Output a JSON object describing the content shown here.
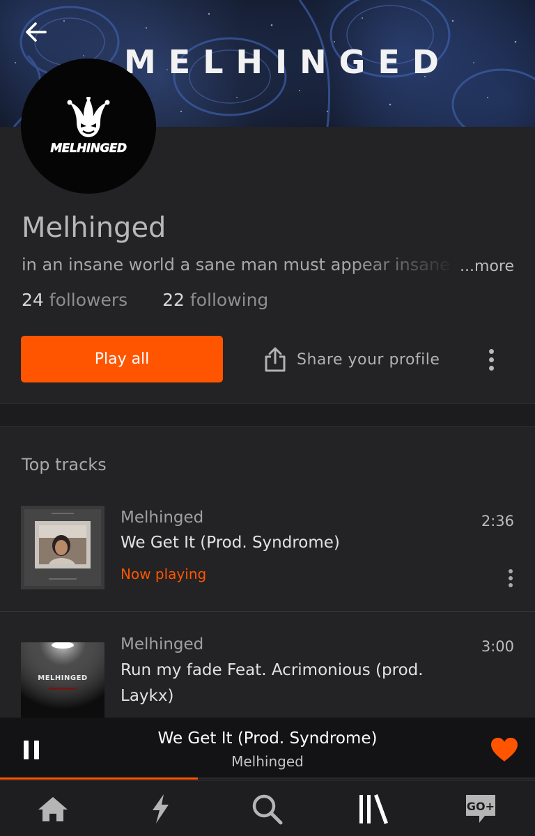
{
  "banner": {
    "title": "MELHINGED"
  },
  "avatar": {
    "logo_text": "MELHINGED"
  },
  "profile": {
    "name": "Melhinged",
    "bio": "in an insane world a sane man must appear insane",
    "more_label": "...more",
    "followers_count": "24",
    "followers_label": "followers",
    "following_count": "22",
    "following_label": "following"
  },
  "actions": {
    "play_all_label": "Play all",
    "share_label": "Share your profile",
    "share_icon": "share-icon",
    "overflow_icon": "more-vertical-icon"
  },
  "top_tracks": {
    "title": "Top tracks",
    "tracks": [
      {
        "artist": "Melhinged",
        "title": "We Get It (Prod. Syndrome)",
        "status": "Now playing",
        "duration": "2:36"
      },
      {
        "artist": "Melhinged",
        "title": "Run my fade Feat. Acrimonious (prod. Laykx)",
        "status": "",
        "duration": "3:00",
        "art_text": "MELHINGED"
      }
    ]
  },
  "mini_player": {
    "title": "We Get It (Prod. Syndrome)",
    "artist": "Melhinged",
    "progress": 0.37,
    "liked": true
  },
  "bottom_nav": {
    "items": [
      "home-icon",
      "stream-icon",
      "search-icon",
      "library-icon",
      "go-plus-icon"
    ],
    "go_label": "GO+"
  },
  "colors": {
    "accent": "#ff5500",
    "background": "#232224",
    "player_bg": "#131214"
  }
}
